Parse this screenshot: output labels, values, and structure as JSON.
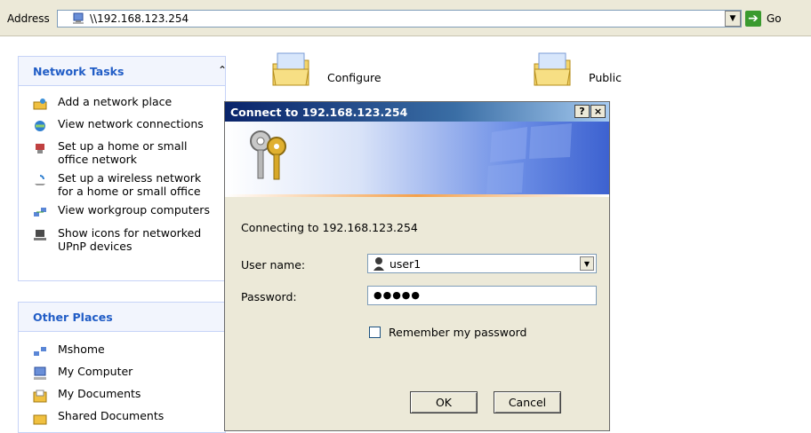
{
  "address_bar": {
    "label": "Address",
    "value": "\\\\192.168.123.254",
    "go_label": "Go"
  },
  "network_tasks": {
    "title": "Network Tasks",
    "items": [
      {
        "label": "Add a network place"
      },
      {
        "label": "View network connections"
      },
      {
        "label": "Set up a home or small office network"
      },
      {
        "label": "Set up a wireless network for a home or small office"
      },
      {
        "label": "View workgroup computers"
      },
      {
        "label": "Show icons for networked UPnP devices"
      }
    ]
  },
  "other_places": {
    "title": "Other Places",
    "items": [
      {
        "label": "Mshome"
      },
      {
        "label": "My Computer"
      },
      {
        "label": "My Documents"
      },
      {
        "label": "Shared Documents"
      }
    ]
  },
  "folders": [
    {
      "label": "Configure"
    },
    {
      "label": "Public"
    }
  ],
  "dialog": {
    "title": "Connect to 192.168.123.254",
    "help_label": "?",
    "close_label": "×",
    "connecting_text": "Connecting to 192.168.123.254",
    "username_label": "User name:",
    "username_value": "user1",
    "password_label": "Password:",
    "password_value": "●●●●●",
    "remember_label": "Remember my password",
    "remember_checked": false,
    "ok_label": "OK",
    "cancel_label": "Cancel"
  },
  "colors": {
    "taskpane_title": "#215dc6",
    "dialog_title_start": "#0a246a",
    "dialog_face": "#ece9d8"
  }
}
